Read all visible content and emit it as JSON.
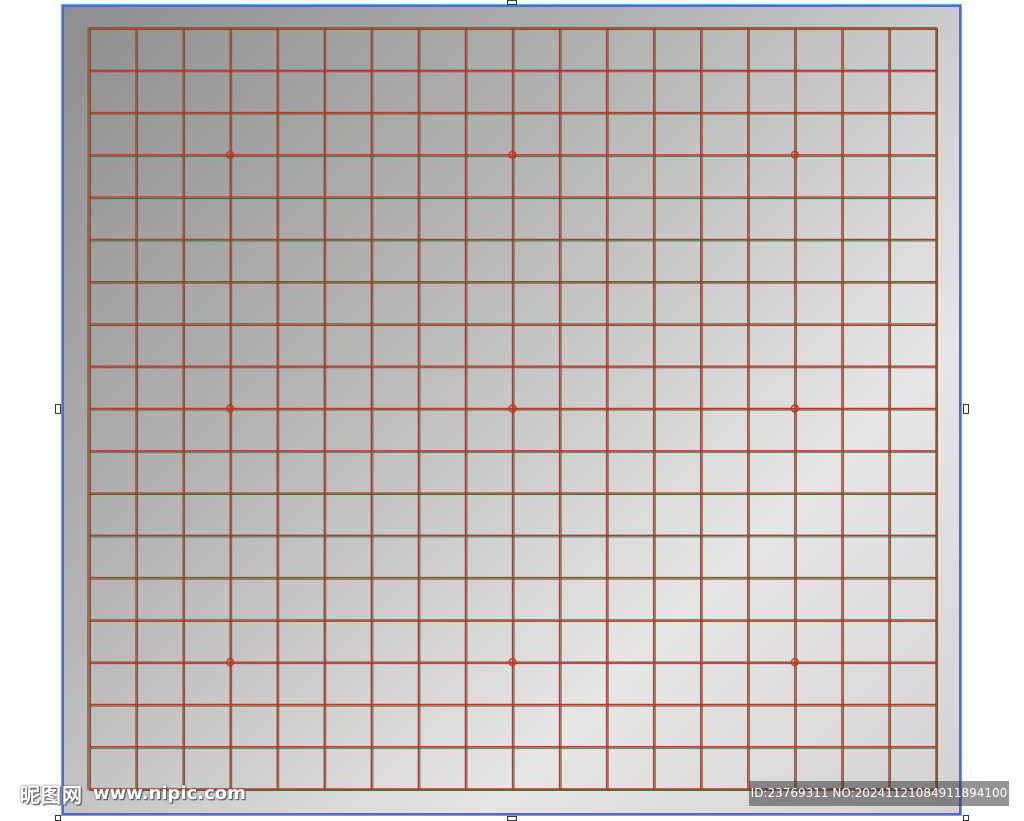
{
  "board": {
    "columns": 18,
    "rows": 18,
    "line_color": "#c8321e",
    "line_shadow_color": "#3f6b3f",
    "frame_color": "#6b5fd0",
    "star_points": [
      {
        "col": 3,
        "row": 3
      },
      {
        "col": 9,
        "row": 3
      },
      {
        "col": 15,
        "row": 3
      },
      {
        "col": 3,
        "row": 9
      },
      {
        "col": 9,
        "row": 9
      },
      {
        "col": 15,
        "row": 9
      },
      {
        "col": 3,
        "row": 15
      },
      {
        "col": 9,
        "row": 15
      },
      {
        "col": 15,
        "row": 15
      }
    ]
  },
  "watermark": {
    "logo_text": "昵图网",
    "site_text": "www.nipic.com",
    "id_text": "ID:23769311 NO:20241121084911894100"
  }
}
